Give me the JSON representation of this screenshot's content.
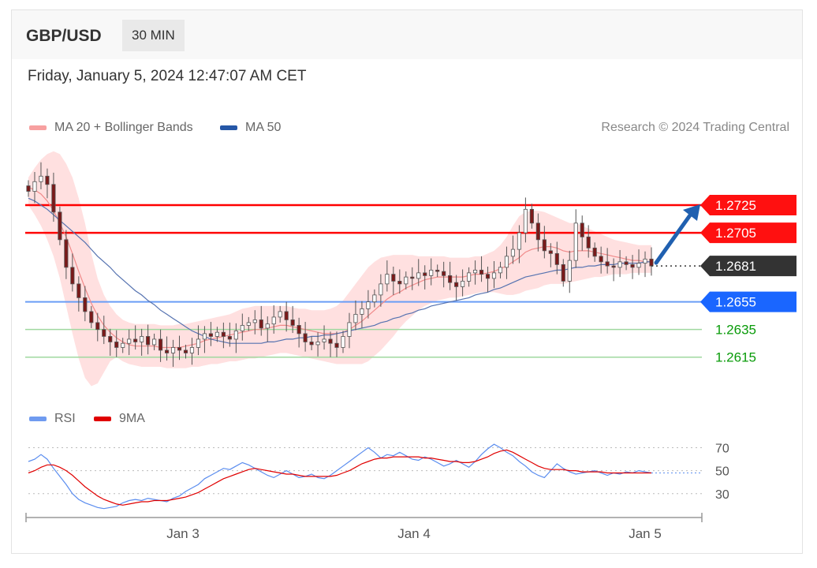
{
  "header": {
    "pair": "GBP/USD",
    "timeframe": "30 MIN"
  },
  "timestamp": "Friday, January 5, 2024 12:47:07 AM CET",
  "legend_main": [
    {
      "label": "MA 20 + Bollinger Bands",
      "color": "#f08080"
    },
    {
      "label": "MA 50",
      "color": "#2557a7"
    }
  ],
  "credit": "Research © 2024 Trading Central",
  "legend_rsi": [
    {
      "label": "RSI",
      "color": "#5b8def"
    },
    {
      "label": "9MA",
      "color": "#e00000"
    }
  ],
  "colors": {
    "resistance": "#ff0000",
    "pivot": "#1a66ff",
    "support": "#0a9b0a",
    "last_price": "#333333",
    "arrow": "#2060b0",
    "bollinger_fill": "#ffd6d6",
    "candle": "#555555",
    "candle_up": "#ffffff",
    "candle_down": "#7a1a1a"
  },
  "chart_data": [
    {
      "type": "candlestick",
      "title": "GBP/USD",
      "ylim": [
        1.2588,
        1.2765
      ],
      "x_ticks": [
        "Jan 3",
        "Jan 4",
        "Jan 5"
      ],
      "price_labels": {
        "r2": "1.2725",
        "r1": "1.2705",
        "last": "1.2681",
        "pivot": "1.2655",
        "s1": "1.2635",
        "s2": "1.2615"
      },
      "levels": [
        {
          "value": 1.2725,
          "kind": "resistance"
        },
        {
          "value": 1.2705,
          "kind": "resistance"
        },
        {
          "value": 1.2655,
          "kind": "pivot"
        },
        {
          "value": 1.2635,
          "kind": "support"
        },
        {
          "value": 1.2615,
          "kind": "support"
        }
      ],
      "last_price": 1.2681,
      "forecast_arrow": {
        "from": 1.2681,
        "to": 1.2725
      },
      "close": [
        1.2735,
        1.2742,
        1.2746,
        1.274,
        1.272,
        1.27,
        1.268,
        1.2668,
        1.2658,
        1.2648,
        1.264,
        1.2635,
        1.263,
        1.2626,
        1.2622,
        1.2625,
        1.2628,
        1.2626,
        1.263,
        1.2624,
        1.2628,
        1.262,
        1.2618,
        1.2622,
        1.262,
        1.2618,
        1.2622,
        1.2628,
        1.2632,
        1.263,
        1.2633,
        1.263,
        1.2628,
        1.2634,
        1.2638,
        1.264,
        1.2642,
        1.2636,
        1.2639,
        1.2644,
        1.2648,
        1.2642,
        1.2638,
        1.2632,
        1.2626,
        1.2624,
        1.2626,
        1.2628,
        1.2625,
        1.2622,
        1.263,
        1.264,
        1.2646,
        1.265,
        1.2655,
        1.266,
        1.2668,
        1.2675,
        1.267,
        1.2668,
        1.2673,
        1.2672,
        1.2676,
        1.2674,
        1.2678,
        1.2677,
        1.2674,
        1.2669,
        1.2666,
        1.267,
        1.2676,
        1.2678,
        1.2675,
        1.2672,
        1.2676,
        1.268,
        1.2688,
        1.2693,
        1.2705,
        1.2722,
        1.2712,
        1.27,
        1.2692,
        1.269,
        1.2682,
        1.267,
        1.2685,
        1.2712,
        1.2702,
        1.2694,
        1.2688,
        1.2684,
        1.2681,
        1.268,
        1.2684,
        1.2682,
        1.268,
        1.2683,
        1.2686,
        1.2681
      ],
      "ma20": [
        1.2738,
        1.2736,
        1.2733,
        1.2728,
        1.2721,
        1.2712,
        1.2702,
        1.269,
        1.2677,
        1.2665,
        1.2654,
        1.2645,
        1.2638,
        1.2633,
        1.2629,
        1.2626,
        1.2624,
        1.2623,
        1.2623,
        1.2623,
        1.2623,
        1.2622,
        1.2622,
        1.2622,
        1.2622,
        1.2623,
        1.2624,
        1.2625,
        1.2627,
        1.2628,
        1.2629,
        1.263,
        1.2631,
        1.2632,
        1.2633,
        1.2634,
        1.2635,
        1.2635,
        1.2636,
        1.2637,
        1.2638,
        1.2638,
        1.2637,
        1.2636,
        1.2635,
        1.2634,
        1.2633,
        1.2632,
        1.2632,
        1.2632,
        1.2633,
        1.2635,
        1.2638,
        1.2641,
        1.2645,
        1.2649,
        1.2653,
        1.2657,
        1.266,
        1.2662,
        1.2665,
        1.2667,
        1.2669,
        1.2671,
        1.2672,
        1.2673,
        1.2673,
        1.2673,
        1.2673,
        1.2673,
        1.2674,
        1.2675,
        1.2675,
        1.2676,
        1.2677,
        1.2679,
        1.2681,
        1.2684,
        1.2687,
        1.2691,
        1.2693,
        1.2694,
        1.2695,
        1.2695,
        1.2694,
        1.2692,
        1.2691,
        1.2692,
        1.2692,
        1.2692,
        1.2691,
        1.269,
        1.2689,
        1.2688,
        1.2687,
        1.2686,
        1.2685,
        1.2685,
        1.2684,
        1.2684
      ],
      "ma50": [
        1.273,
        1.2728,
        1.2725,
        1.2722,
        1.2718,
        1.2714,
        1.271,
        1.2706,
        1.2702,
        1.2698,
        1.2693,
        1.2688,
        1.2684,
        1.268,
        1.2675,
        1.2671,
        1.2667,
        1.2663,
        1.266,
        1.2656,
        1.2653,
        1.2649,
        1.2646,
        1.2643,
        1.264,
        1.2637,
        1.2634,
        1.2632,
        1.263,
        1.2628,
        1.2627,
        1.2626,
        1.2625,
        1.2625,
        1.2625,
        1.2625,
        1.2625,
        1.2625,
        1.2626,
        1.2626,
        1.2627,
        1.2628,
        1.2628,
        1.2629,
        1.2629,
        1.263,
        1.263,
        1.2631,
        1.2631,
        1.2632,
        1.2633,
        1.2634,
        1.2635,
        1.2636,
        1.2637,
        1.2638,
        1.264,
        1.2641,
        1.2643,
        1.2644,
        1.2646,
        1.2647,
        1.2649,
        1.265,
        1.2652,
        1.2653,
        1.2654,
        1.2655,
        1.2656,
        1.2657,
        1.2658,
        1.266,
        1.2661,
        1.2662,
        1.2664,
        1.2665,
        1.2667,
        1.2669,
        1.2671,
        1.2673,
        1.2674,
        1.2675,
        1.2676,
        1.2677,
        1.2678,
        1.2678,
        1.2679,
        1.268,
        1.268,
        1.2681,
        1.2681,
        1.2682,
        1.2682,
        1.2682,
        1.2683,
        1.2683,
        1.2683,
        1.2683,
        1.2684,
        1.2684
      ],
      "bb_upper": [
        1.2745,
        1.2752,
        1.2758,
        1.2762,
        1.2764,
        1.2762,
        1.2755,
        1.2745,
        1.273,
        1.2712,
        1.269,
        1.2672,
        1.266,
        1.2652,
        1.2646,
        1.2642,
        1.264,
        1.2639,
        1.2639,
        1.2639,
        1.2639,
        1.2638,
        1.2638,
        1.2638,
        1.2639,
        1.2639,
        1.264,
        1.2641,
        1.2642,
        1.2643,
        1.2644,
        1.2645,
        1.2646,
        1.2648,
        1.265,
        1.2651,
        1.2652,
        1.2652,
        1.2652,
        1.2652,
        1.2652,
        1.2652,
        1.2651,
        1.265,
        1.265,
        1.2649,
        1.2649,
        1.2649,
        1.265,
        1.2652,
        1.2656,
        1.2662,
        1.2668,
        1.2674,
        1.268,
        1.2684,
        1.2687,
        1.2688,
        1.2689,
        1.2689,
        1.2689,
        1.2689,
        1.2688,
        1.2688,
        1.2688,
        1.2688,
        1.2688,
        1.2687,
        1.2687,
        1.2687,
        1.2687,
        1.2688,
        1.2688,
        1.269,
        1.2692,
        1.2696,
        1.2702,
        1.271,
        1.2717,
        1.272,
        1.2721,
        1.2721,
        1.272,
        1.2718,
        1.2716,
        1.2714,
        1.2712,
        1.2712,
        1.271,
        1.2708,
        1.2706,
        1.2704,
        1.2702,
        1.27,
        1.2699,
        1.2698,
        1.2697,
        1.2696,
        1.2696,
        1.2696
      ],
      "bb_lower": [
        1.2725,
        1.2718,
        1.271,
        1.27,
        1.2688,
        1.2672,
        1.2652,
        1.2632,
        1.2614,
        1.26,
        1.2594,
        1.2596,
        1.2604,
        1.2612,
        1.2615,
        1.2612,
        1.261,
        1.2609,
        1.2608,
        1.2608,
        1.2608,
        1.2608,
        1.2607,
        1.2607,
        1.2607,
        1.2607,
        1.2608,
        1.2608,
        1.2609,
        1.261,
        1.261,
        1.2611,
        1.2612,
        1.2612,
        1.2613,
        1.2614,
        1.2614,
        1.2615,
        1.2616,
        1.2617,
        1.2618,
        1.2618,
        1.2617,
        1.2616,
        1.2615,
        1.2614,
        1.2613,
        1.2612,
        1.2611,
        1.261,
        1.261,
        1.261,
        1.261,
        1.261,
        1.2612,
        1.2616,
        1.262,
        1.2625,
        1.263,
        1.2636,
        1.2641,
        1.2645,
        1.2649,
        1.2652,
        1.2654,
        1.2656,
        1.2657,
        1.2658,
        1.2658,
        1.2659,
        1.266,
        1.2661,
        1.2662,
        1.2662,
        1.2662,
        1.2661,
        1.266,
        1.266,
        1.2661,
        1.2663,
        1.2664,
        1.2665,
        1.2667,
        1.2668,
        1.2668,
        1.2668,
        1.2669,
        1.267,
        1.2671,
        1.2672,
        1.2673,
        1.2673,
        1.2674,
        1.2675,
        1.2675,
        1.2675,
        1.2676,
        1.2676,
        1.2676,
        1.2676
      ]
    },
    {
      "type": "line",
      "title": "RSI",
      "ylim": [
        12,
        82
      ],
      "y_ticks": [
        70,
        50,
        30
      ],
      "series": [
        {
          "name": "RSI",
          "values": [
            58,
            60,
            64,
            60,
            52,
            45,
            38,
            30,
            25,
            22,
            20,
            18,
            17,
            18,
            19,
            22,
            24,
            25,
            24,
            26,
            25,
            24,
            23,
            26,
            28,
            32,
            35,
            38,
            43,
            46,
            49,
            52,
            51,
            54,
            57,
            55,
            52,
            49,
            46,
            44,
            47,
            50,
            47,
            44,
            45,
            47,
            44,
            43,
            46,
            50,
            54,
            58,
            62,
            66,
            70,
            66,
            61,
            64,
            63,
            66,
            63,
            60,
            59,
            62,
            60,
            57,
            54,
            56,
            59,
            56,
            53,
            58,
            64,
            69,
            73,
            70,
            66,
            63,
            58,
            54,
            49,
            46,
            44,
            50,
            56,
            52,
            49,
            47,
            48,
            49,
            50,
            48,
            46,
            48,
            47,
            49,
            48,
            50,
            49,
            48
          ]
        },
        {
          "name": "9MA",
          "values": [
            48,
            50,
            53,
            55,
            55,
            53,
            50,
            46,
            41,
            36,
            32,
            28,
            25,
            23,
            21,
            20,
            21,
            22,
            23,
            23,
            24,
            24,
            24,
            25,
            26,
            27,
            29,
            31,
            34,
            37,
            40,
            43,
            45,
            47,
            49,
            51,
            52,
            51,
            50,
            49,
            48,
            47,
            47,
            46,
            45,
            45,
            45,
            45,
            45,
            46,
            48,
            50,
            53,
            56,
            58,
            60,
            61,
            61,
            62,
            62,
            62,
            62,
            62,
            61,
            61,
            60,
            59,
            58,
            58,
            57,
            57,
            58,
            60,
            62,
            65,
            67,
            68,
            66,
            63,
            60,
            57,
            54,
            52,
            51,
            51,
            51,
            50,
            50,
            49,
            49,
            49,
            49,
            48,
            48,
            48,
            48,
            48,
            48,
            48,
            48
          ]
        }
      ]
    }
  ]
}
